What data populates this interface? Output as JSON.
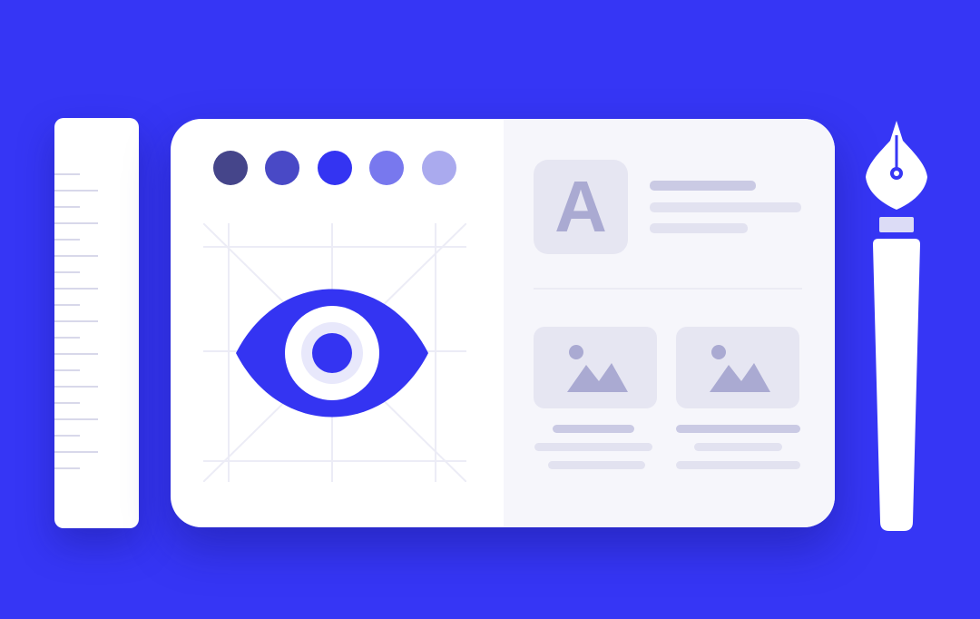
{
  "illustration": {
    "letter_tile": {
      "letter": "A"
    },
    "colors": {
      "background": "#3636f5",
      "card": "#ffffff",
      "panel": "#f6f6fb",
      "placeholder": "#e6e6f2",
      "placeholder_dark": "#aaaad2",
      "accent": "#3434f2"
    },
    "palette_swatches": [
      "#45458a",
      "#4949c6",
      "#3434f2",
      "#7878ee",
      "#aaaaee"
    ],
    "icons": [
      "ruler-icon",
      "eye-icon",
      "image-icon",
      "image-icon",
      "fountain-pen-icon"
    ]
  }
}
